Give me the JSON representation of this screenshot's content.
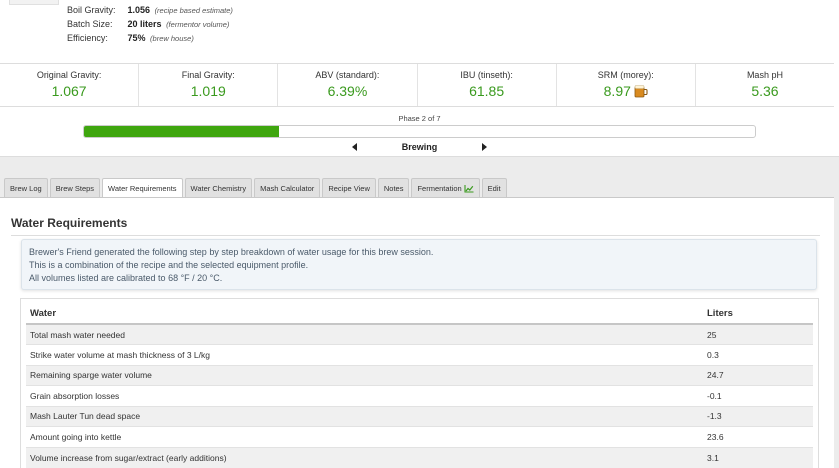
{
  "recipe": {
    "boil_gravity": {
      "label": "Boil Gravity:",
      "value": "1.056",
      "note": "(recipe based estimate)"
    },
    "batch_size": {
      "label": "Batch Size:",
      "value": "20 liters",
      "note": "(fermentor volume)"
    },
    "efficiency": {
      "label": "Efficiency:",
      "value": "75%",
      "note": "(brew house)"
    }
  },
  "stats": [
    {
      "label": "Original Gravity:",
      "value": "1.067"
    },
    {
      "label": "Final Gravity:",
      "value": "1.019"
    },
    {
      "label": "ABV (standard):",
      "value": "6.39%"
    },
    {
      "label": "IBU (tinseth):",
      "value": "61.85"
    },
    {
      "label": "SRM (morey):",
      "value": "8.97",
      "icon": "beer-mug-icon"
    },
    {
      "label": "Mash pH",
      "value": "5.36"
    }
  ],
  "phase": {
    "label": "Phase 2 of 7",
    "name": "Brewing",
    "progress": 0.29
  },
  "tabs": [
    {
      "label": "Brew Log"
    },
    {
      "label": "Brew Steps"
    },
    {
      "label": "Water Requirements",
      "active": true
    },
    {
      "label": "Water Chemistry"
    },
    {
      "label": "Mash Calculator"
    },
    {
      "label": "Recipe View"
    },
    {
      "label": "Notes"
    },
    {
      "label": "Fermentation",
      "icon": "line-chart-icon"
    },
    {
      "label": "Edit"
    }
  ],
  "section": {
    "title": "Water Requirements",
    "info_lines": [
      "Brewer's Friend generated the following step by step breakdown of water usage for this brew session.",
      "This is a combination of the recipe and the selected equipment profile.",
      "All volumes listed are calibrated to 68 °F / 20 °C."
    ]
  },
  "water_table": {
    "headers": [
      "Water",
      "Liters"
    ],
    "rows": [
      [
        "Total mash water needed",
        "25"
      ],
      [
        "Strike water volume at mash thickness of 3 L/kg",
        "0.3"
      ],
      [
        "Remaining sparge water volume",
        "24.7"
      ],
      [
        "Grain absorption losses",
        "-0.1"
      ],
      [
        "Mash Lauter Tun dead space",
        "-1.3"
      ],
      [
        "Amount going into kettle",
        "23.6"
      ],
      [
        "Volume increase from sugar/extract (early additions)",
        "3.1"
      ]
    ]
  },
  "colors": {
    "accent_green": "#3a9a1e",
    "progress_green": "#3fa60f",
    "beer_amber": "#d98a1f"
  }
}
